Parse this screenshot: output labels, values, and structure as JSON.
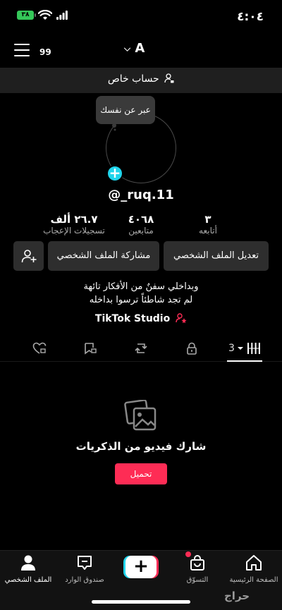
{
  "status_bar": {
    "time": "٤:٠٤",
    "battery": "٣٨"
  },
  "header": {
    "notification_count": "99",
    "account_name": "A"
  },
  "private_label": "حساب خاص",
  "avatar": {
    "bubble_text": "عبر عن نفسك"
  },
  "username": "@_ruq.11",
  "stats": [
    {
      "value": "٣",
      "label": "أتابعه"
    },
    {
      "value": "٤٠٦٨",
      "label": "متابعين"
    },
    {
      "value": "٢٦.٧ ألف",
      "label": "تسجيلات الإعجاب"
    }
  ],
  "buttons": {
    "edit_profile": "تعديل الملف الشخصي",
    "share_profile": "مشاركة الملف الشخصي"
  },
  "bio": {
    "line1": "وبداخلي سفنٌ من الأفكار تائهة",
    "line2": "لم تجد شاطئاً ترسوا بداخله"
  },
  "studio_label": "TikTok Studio",
  "tabs": {
    "videos_count": "3"
  },
  "empty_state": {
    "message": "شارك فيديو من الذكريات",
    "upload_label": "تحميل"
  },
  "bottom_nav": [
    {
      "label": "الصفحة الرئيسية"
    },
    {
      "label": "التسوّق"
    },
    {
      "label": ""
    },
    {
      "label": "صندوق الوارد"
    },
    {
      "label": "الملف الشخصي"
    }
  ],
  "watermark": "حراج",
  "colors": {
    "accent_red": "#fe2c55",
    "accent_cyan": "#20d5ec",
    "battery_green": "#35c759"
  }
}
